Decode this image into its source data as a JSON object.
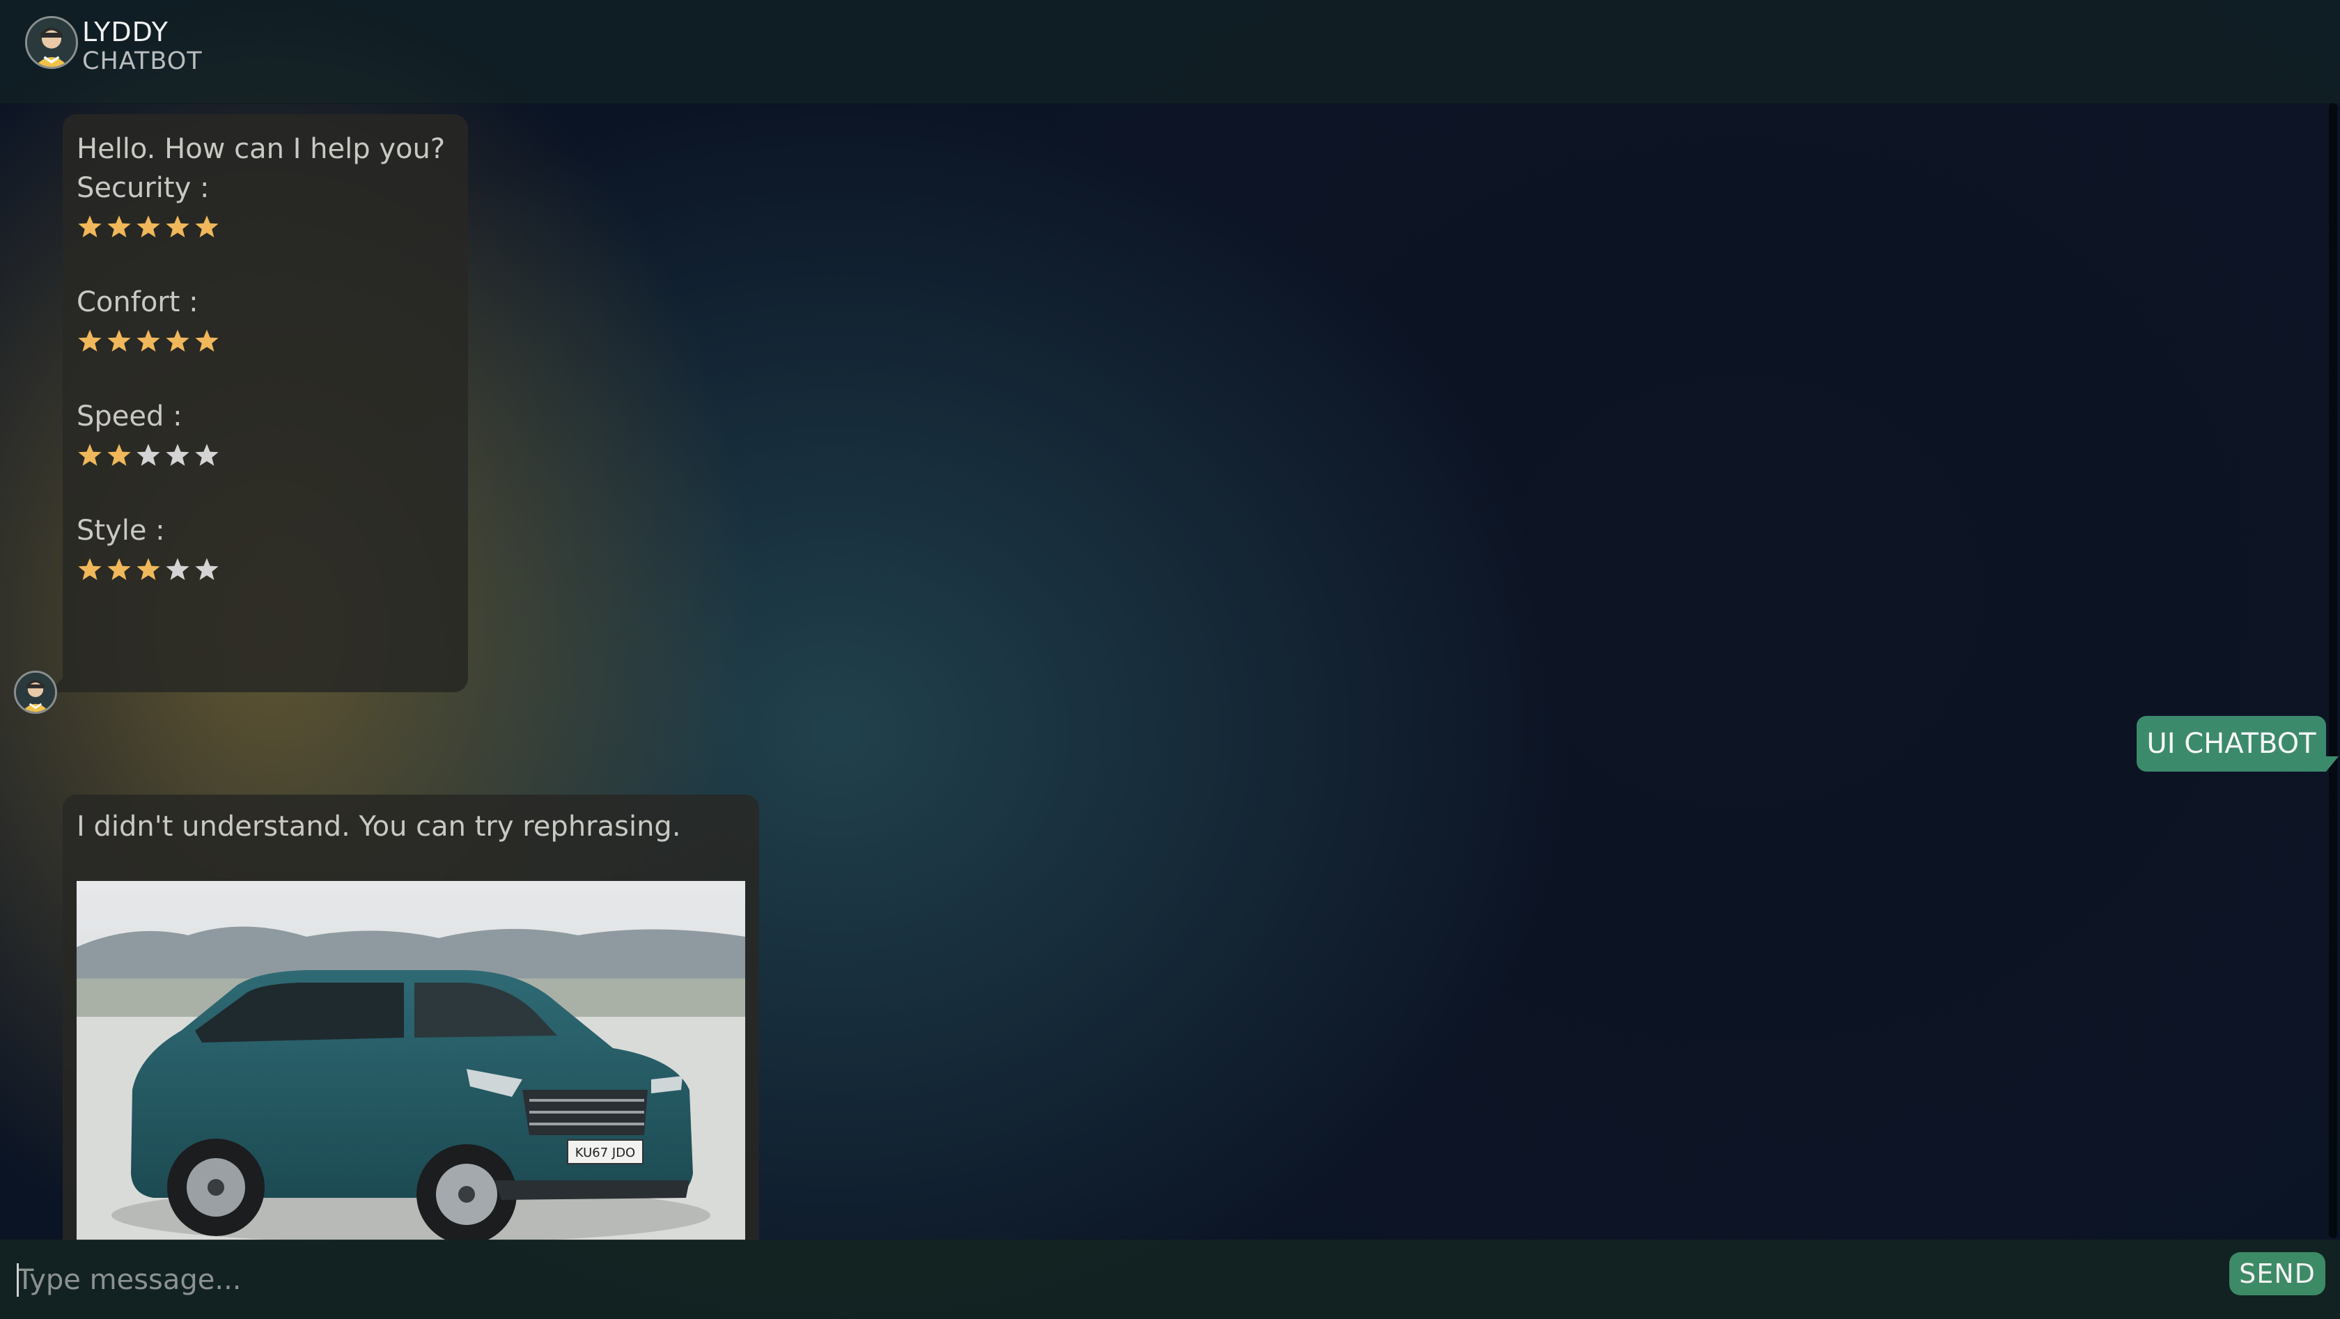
{
  "header": {
    "title": "LYDDY",
    "subtitle": "CHATBOT",
    "avatar_icon": "assistant-avatar-icon"
  },
  "colors": {
    "star_filled": "#f0b85a",
    "star_empty": "#d4d4d4",
    "user_bubble": "#3c8a6c",
    "send_button": "#3d8a66"
  },
  "messages": {
    "bot_1": {
      "greeting": "Hello. How can I help you?",
      "ratings": [
        {
          "label": "Security :",
          "stars": 5,
          "max": 5
        },
        {
          "label": "Confort :",
          "stars": 5,
          "max": 5
        },
        {
          "label": "Speed :",
          "stars": 2,
          "max": 5
        },
        {
          "label": "Style :",
          "stars": 3,
          "max": 5
        }
      ]
    },
    "user_1": {
      "text": "UI CHATBOT"
    },
    "bot_2": {
      "text": "I didn't understand. You can try rephrasing.",
      "image": {
        "plate": "KU67 JDO"
      }
    }
  },
  "composer": {
    "placeholder": "Type message...",
    "value": "",
    "send_label": "SEND"
  }
}
